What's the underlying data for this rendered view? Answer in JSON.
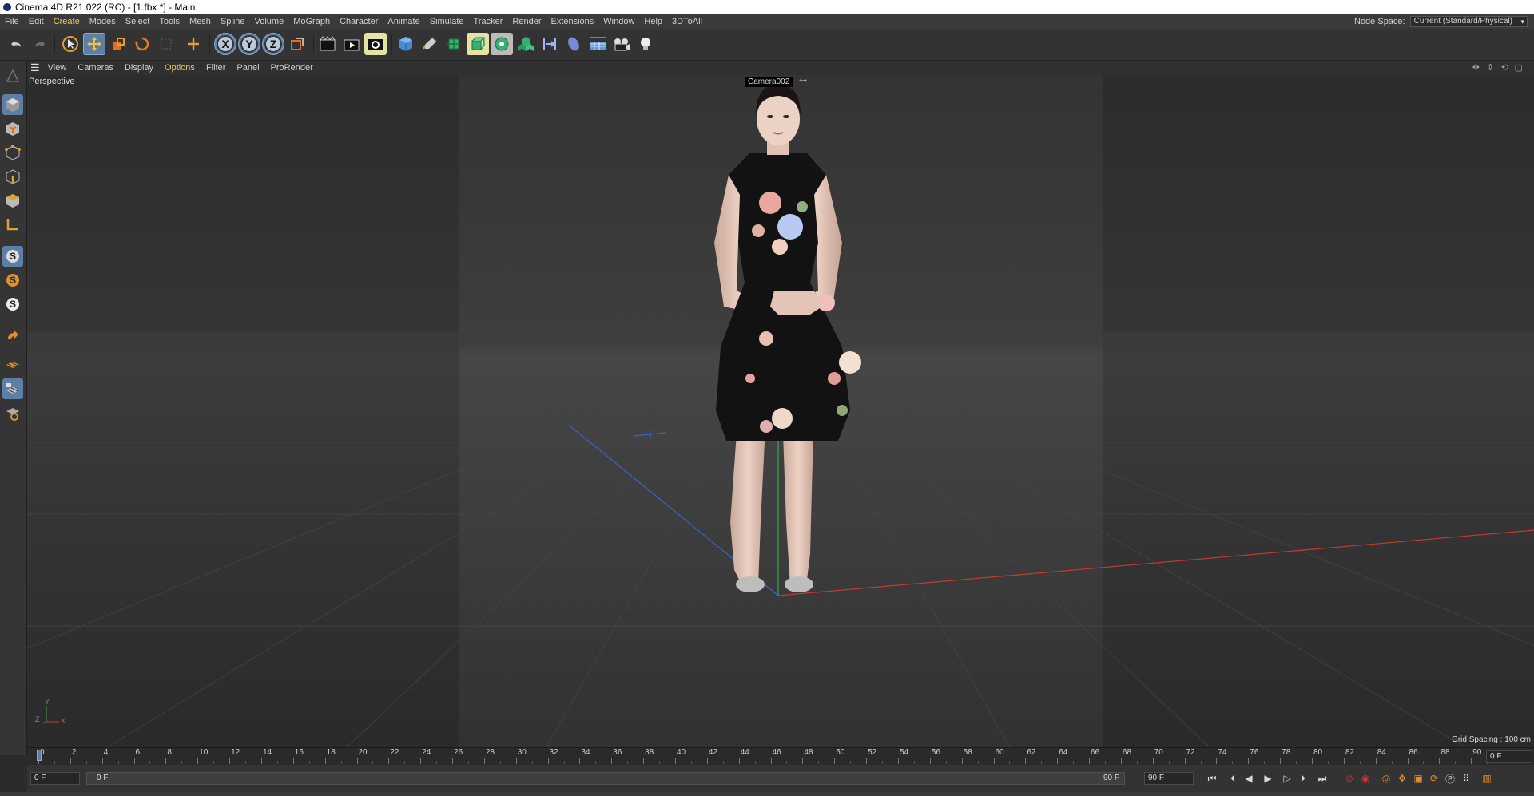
{
  "window": {
    "title": "Cinema 4D R21.022 (RC) - [1.fbx *] - Main"
  },
  "menu": [
    "File",
    "Edit",
    "Create",
    "Modes",
    "Select",
    "Tools",
    "Mesh",
    "Spline",
    "Volume",
    "MoGraph",
    "Character",
    "Animate",
    "Simulate",
    "Tracker",
    "Render",
    "Extensions",
    "Window",
    "Help",
    "3DToAll"
  ],
  "menu_highlight": [
    "Create"
  ],
  "node_space": {
    "label": "Node Space:",
    "value": "Current (Standard/Physical)"
  },
  "toolbar": {
    "x_label": "X",
    "y_label": "Y",
    "z_label": "Z"
  },
  "viewport_menu": [
    "View",
    "Cameras",
    "Display",
    "Options",
    "Filter",
    "Panel",
    "ProRender"
  ],
  "viewport_menu_highlight": "Options",
  "viewport": {
    "label": "Perspective",
    "camera": "Camera002",
    "grid_spacing": "Grid Spacing : 100 cm",
    "axis_y": "Y",
    "axis_z": "Z",
    "axis_x": "X"
  },
  "timeline": {
    "ticks": [
      "0",
      "2",
      "4",
      "6",
      "8",
      "10",
      "12",
      "14",
      "16",
      "18",
      "20",
      "22",
      "24",
      "26",
      "28",
      "30",
      "32",
      "34",
      "36",
      "38",
      "40",
      "42",
      "44",
      "46",
      "48",
      "50",
      "52",
      "54",
      "56",
      "58",
      "60",
      "62",
      "64",
      "66",
      "68",
      "70",
      "72",
      "74",
      "76",
      "78",
      "80",
      "82",
      "84",
      "86",
      "88",
      "90"
    ],
    "current_frame": "0 F"
  },
  "transport": {
    "start_field": "0 F",
    "range_start": "0 F",
    "range_end": "90 F",
    "end_field": "90 F"
  },
  "colors": {
    "accent_yellow": "#e8c96a",
    "selected_blue": "#5d7ea5",
    "axis_red": "#c43a33",
    "axis_green": "#2fae4a",
    "axis_blue": "#3a64c8"
  }
}
